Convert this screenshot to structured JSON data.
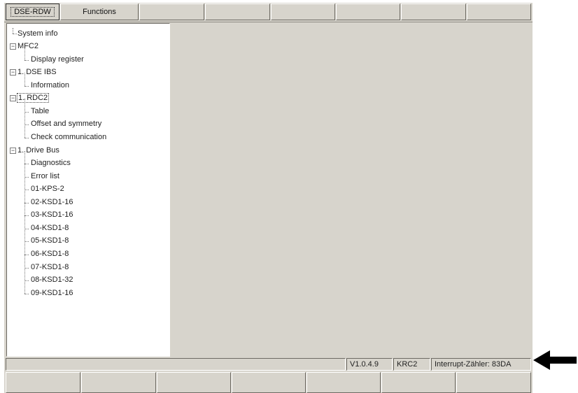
{
  "menubar": {
    "buttons": [
      "DSE-RDW",
      "Functions",
      "",
      "",
      "",
      "",
      "",
      ""
    ]
  },
  "tree": {
    "items": [
      {
        "label": "System info"
      },
      {
        "label": "MFC2"
      },
      {
        "label": "Display register"
      },
      {
        "label": "1. DSE IBS"
      },
      {
        "label": "Information"
      },
      {
        "label": "1. RDC2"
      },
      {
        "label": "Table"
      },
      {
        "label": "Offset and symmetry"
      },
      {
        "label": "Check communication"
      },
      {
        "label": "1. Drive Bus"
      },
      {
        "label": "Diagnostics"
      },
      {
        "label": "Error list"
      },
      {
        "label": "01-KPS-2"
      },
      {
        "label": "02-KSD1-16"
      },
      {
        "label": "03-KSD1-16"
      },
      {
        "label": "04-KSD1-8"
      },
      {
        "label": "05-KSD1-8"
      },
      {
        "label": "06-KSD1-8"
      },
      {
        "label": "07-KSD1-8"
      },
      {
        "label": "08-KSD1-32"
      },
      {
        "label": "09-KSD1-16"
      }
    ],
    "expander_symbol": "−"
  },
  "statusbar": {
    "message": "",
    "version": "V1.0.4.9",
    "controller": "KRC2",
    "interrupt_counter": "Interrupt-Zähler: 83DA"
  },
  "softkeys": [
    "",
    "",
    "",
    "",
    "",
    "",
    ""
  ],
  "colors": {
    "face": "#d7d4cc",
    "panel": "#ffffff",
    "arrow": "#000000"
  },
  "icons": {
    "annotation": "left-arrow-icon"
  }
}
